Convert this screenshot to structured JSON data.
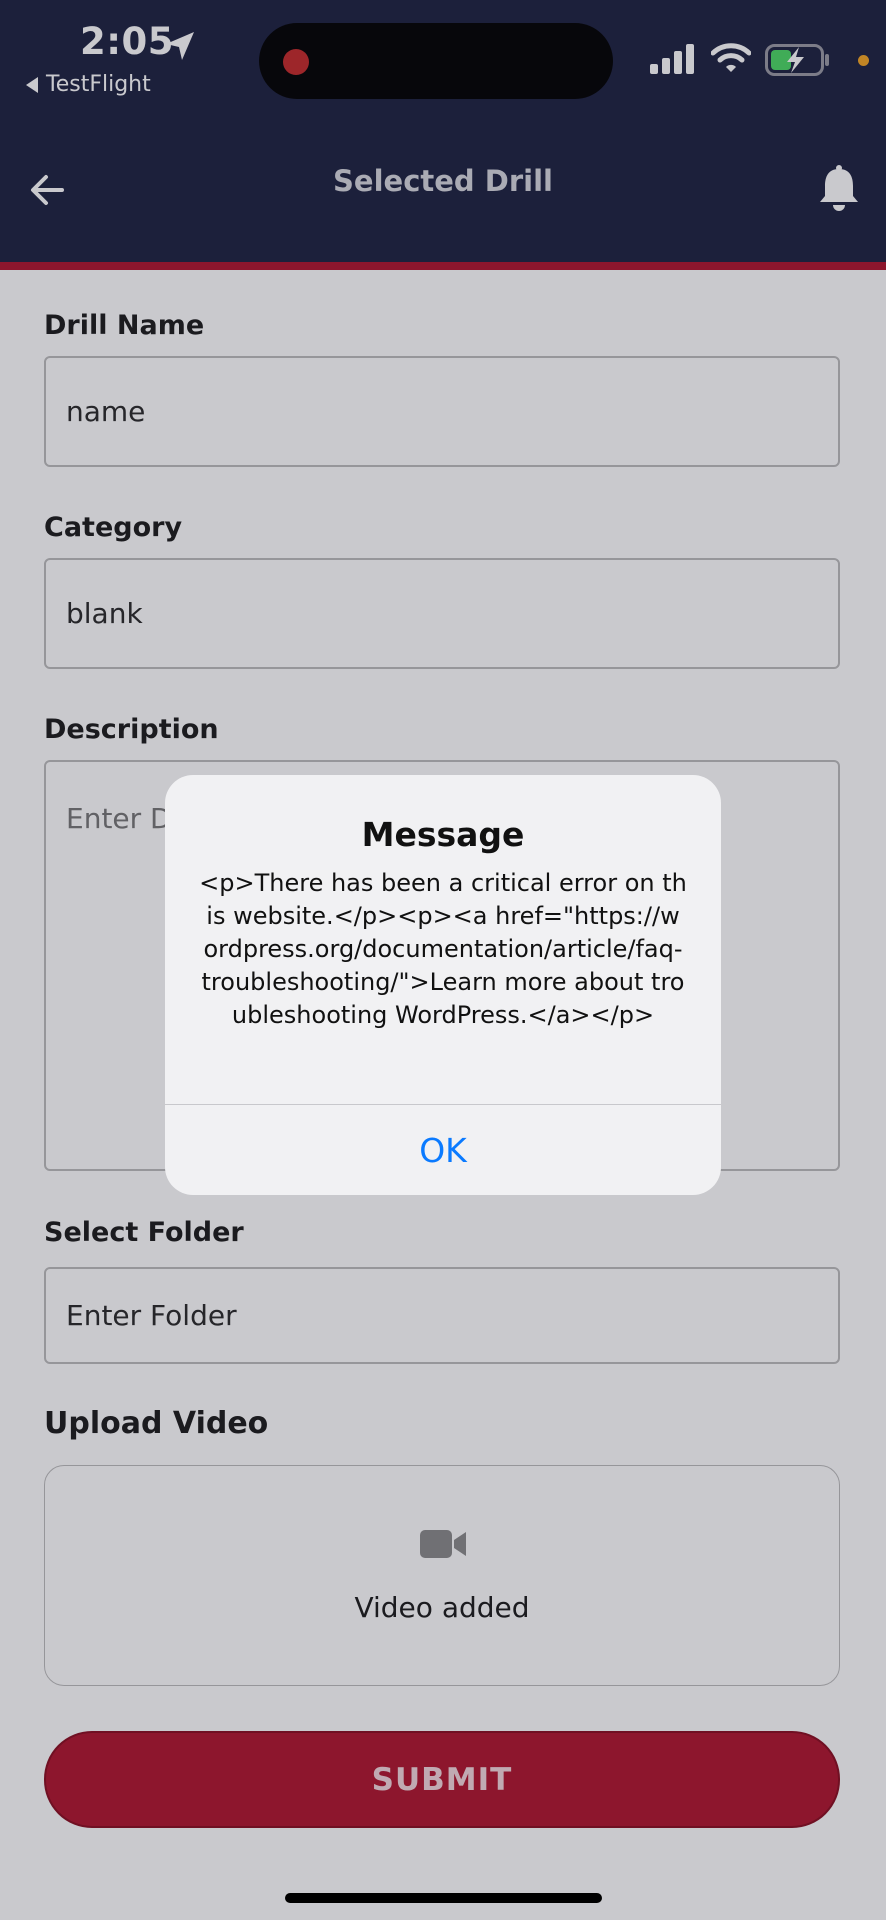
{
  "status_bar": {
    "time": "2:05",
    "back_app": "TestFlight"
  },
  "nav": {
    "title": "Selected Drill",
    "back_icon": "arrow-left-icon",
    "bell_icon": "bell-icon"
  },
  "form": {
    "drill_name": {
      "label": "Drill Name",
      "value": "name"
    },
    "category": {
      "label": "Category",
      "value": "blank"
    },
    "description": {
      "label": "Description",
      "placeholder": "Enter Description"
    },
    "folder": {
      "label": "Select Folder",
      "placeholder": "Enter Folder"
    },
    "upload": {
      "label": "Upload Video",
      "status": "Video added",
      "icon": "video-camera-icon"
    },
    "submit_label": "SUBMIT"
  },
  "alert": {
    "title": "Message",
    "message": "<p>There has been a critical error on this website.</p><p><a href=\"https://wordpress.org/documentation/article/faq-troubleshooting/\">Learn more about troubleshooting WordPress.</a></p>",
    "ok_label": "OK"
  },
  "colors": {
    "header_bg": "#1c2140",
    "accent": "#b0152d",
    "ok_blue": "#0a7aff"
  }
}
